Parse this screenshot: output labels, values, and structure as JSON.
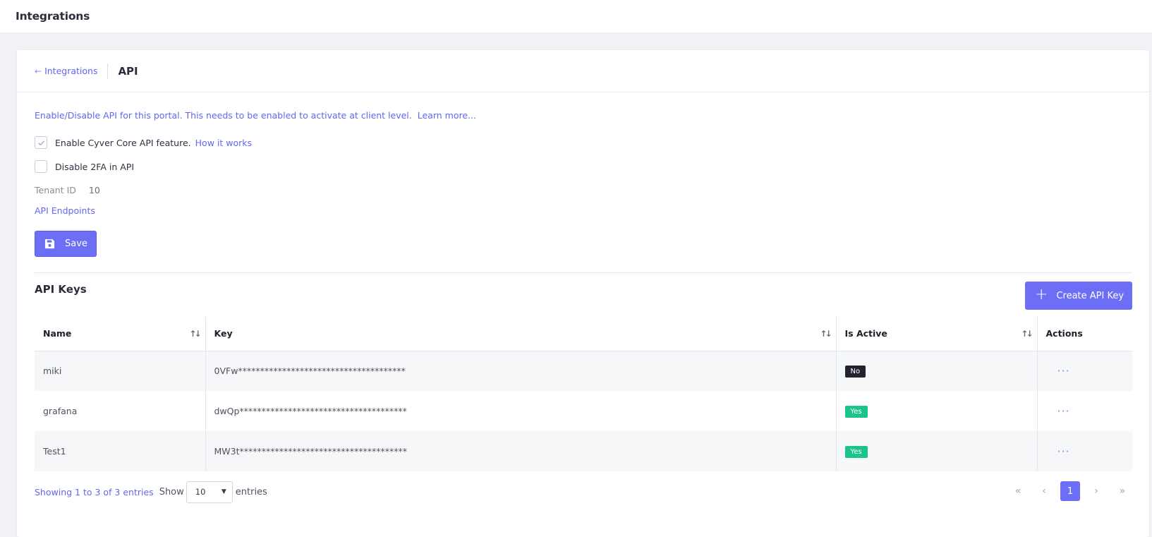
{
  "topbar": {
    "title": "Integrations"
  },
  "header": {
    "back_label": "Integrations",
    "title": "API"
  },
  "settings": {
    "intro_text": "Enable/Disable API for this portal. This needs to be enabled to activate at client level.",
    "learn_more": "Learn more...",
    "enable_label": "Enable Cyver Core API feature.",
    "enable_checked": true,
    "how_it_works": "How it works",
    "disable_2fa_label": "Disable 2FA in API",
    "disable_2fa_checked": false,
    "tenant_label": "Tenant ID",
    "tenant_value": "10",
    "endpoints_link": "API Endpoints",
    "save_label": "Save"
  },
  "keys": {
    "title": "API Keys",
    "create_label": "Create API Key",
    "columns": [
      "Name",
      "Key",
      "Is Active",
      "Actions"
    ],
    "rows": [
      {
        "name": "miki",
        "key": "0VFw**************************************",
        "active": "No"
      },
      {
        "name": "grafana",
        "key": "dwQp**************************************",
        "active": "Yes"
      },
      {
        "name": "Test1",
        "key": "MW3t**************************************",
        "active": "Yes"
      }
    ],
    "actions_icon": "···"
  },
  "footer": {
    "info": "Showing 1 to 3 of 3 entries",
    "show_label": "Show",
    "page_size": "10",
    "entries_label": "entries",
    "current_page": "1"
  },
  "colors": {
    "accent": "#6c6ff5",
    "yes": "#1cc38c",
    "no": "#23232f"
  }
}
